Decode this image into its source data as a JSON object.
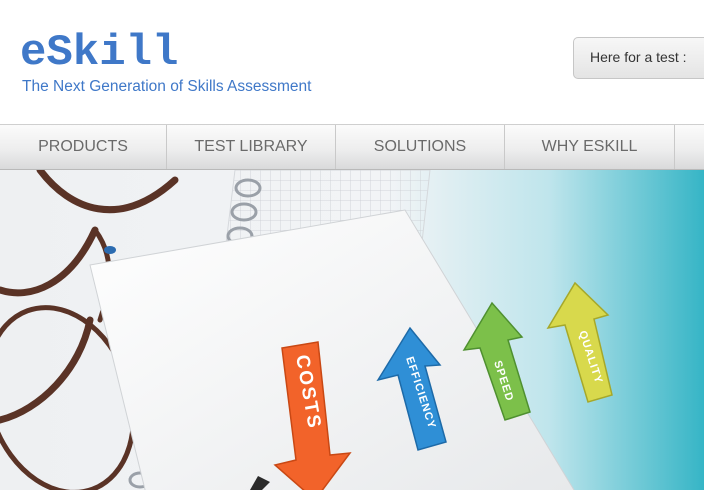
{
  "brand": {
    "logo": "eSkill",
    "tagline": "The Next Generation of Skills Assessment"
  },
  "header": {
    "test_button_label": "Here for a test :"
  },
  "nav": {
    "items": [
      {
        "label": "PRODUCTS"
      },
      {
        "label": "TEST LIBRARY"
      },
      {
        "label": "SOLUTIONS"
      },
      {
        "label": "WHY ESKILL"
      }
    ]
  },
  "hero": {
    "arrows": [
      {
        "label": "COSTS",
        "color": "#f2632a",
        "direction": "down"
      },
      {
        "label": "EFFICIENCY",
        "color": "#2f8fd6",
        "direction": "up"
      },
      {
        "label": "SPEED",
        "color": "#7cc04a",
        "direction": "up"
      },
      {
        "label": "QUALITY",
        "color": "#d8d94c",
        "direction": "up"
      }
    ],
    "colors": {
      "background_left": "#f3f4f6",
      "background_right": "#36b5c6"
    }
  }
}
